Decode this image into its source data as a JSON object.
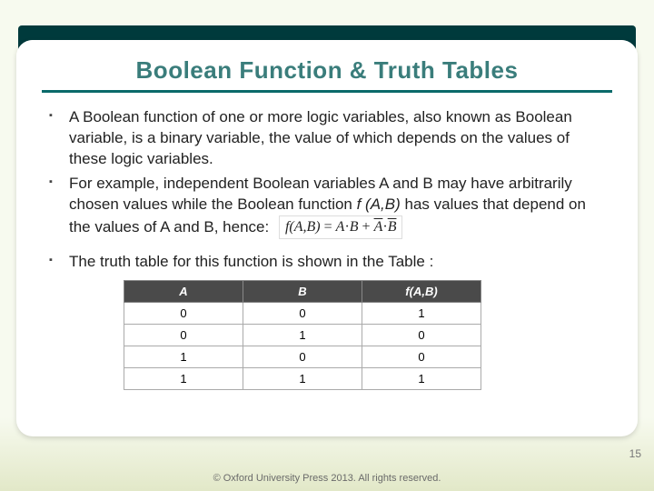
{
  "title": "Boolean Function & Truth Tables",
  "bullets": {
    "b1": "A Boolean function of one or more logic variables, also known as Boolean variable, is a binary variable, the value of which depends on the values of these logic variables.",
    "b2_pre": "For example, independent Boolean variables A and B may have arbitrarily chosen values while the Boolean function ",
    "b2_em": "f (A,B)",
    "b2_post": " has values that depend on the values of A and B, hence:",
    "b3": "The truth table for this function is shown in the Table :"
  },
  "formula": {
    "lhs": "f(A,B)",
    "eq": " = ",
    "t1a": "A",
    "dot": "·",
    "t1b": "B",
    "plus": " + ",
    "t2a": "A",
    "t2b": "B"
  },
  "truth_table": {
    "headers": [
      "A",
      "B",
      "f(A,B)"
    ],
    "rows": [
      [
        "0",
        "0",
        "1"
      ],
      [
        "0",
        "1",
        "0"
      ],
      [
        "1",
        "0",
        "0"
      ],
      [
        "1",
        "1",
        "1"
      ]
    ]
  },
  "page_number": "15",
  "footer": "© Oxford University Press 2013. All rights reserved."
}
